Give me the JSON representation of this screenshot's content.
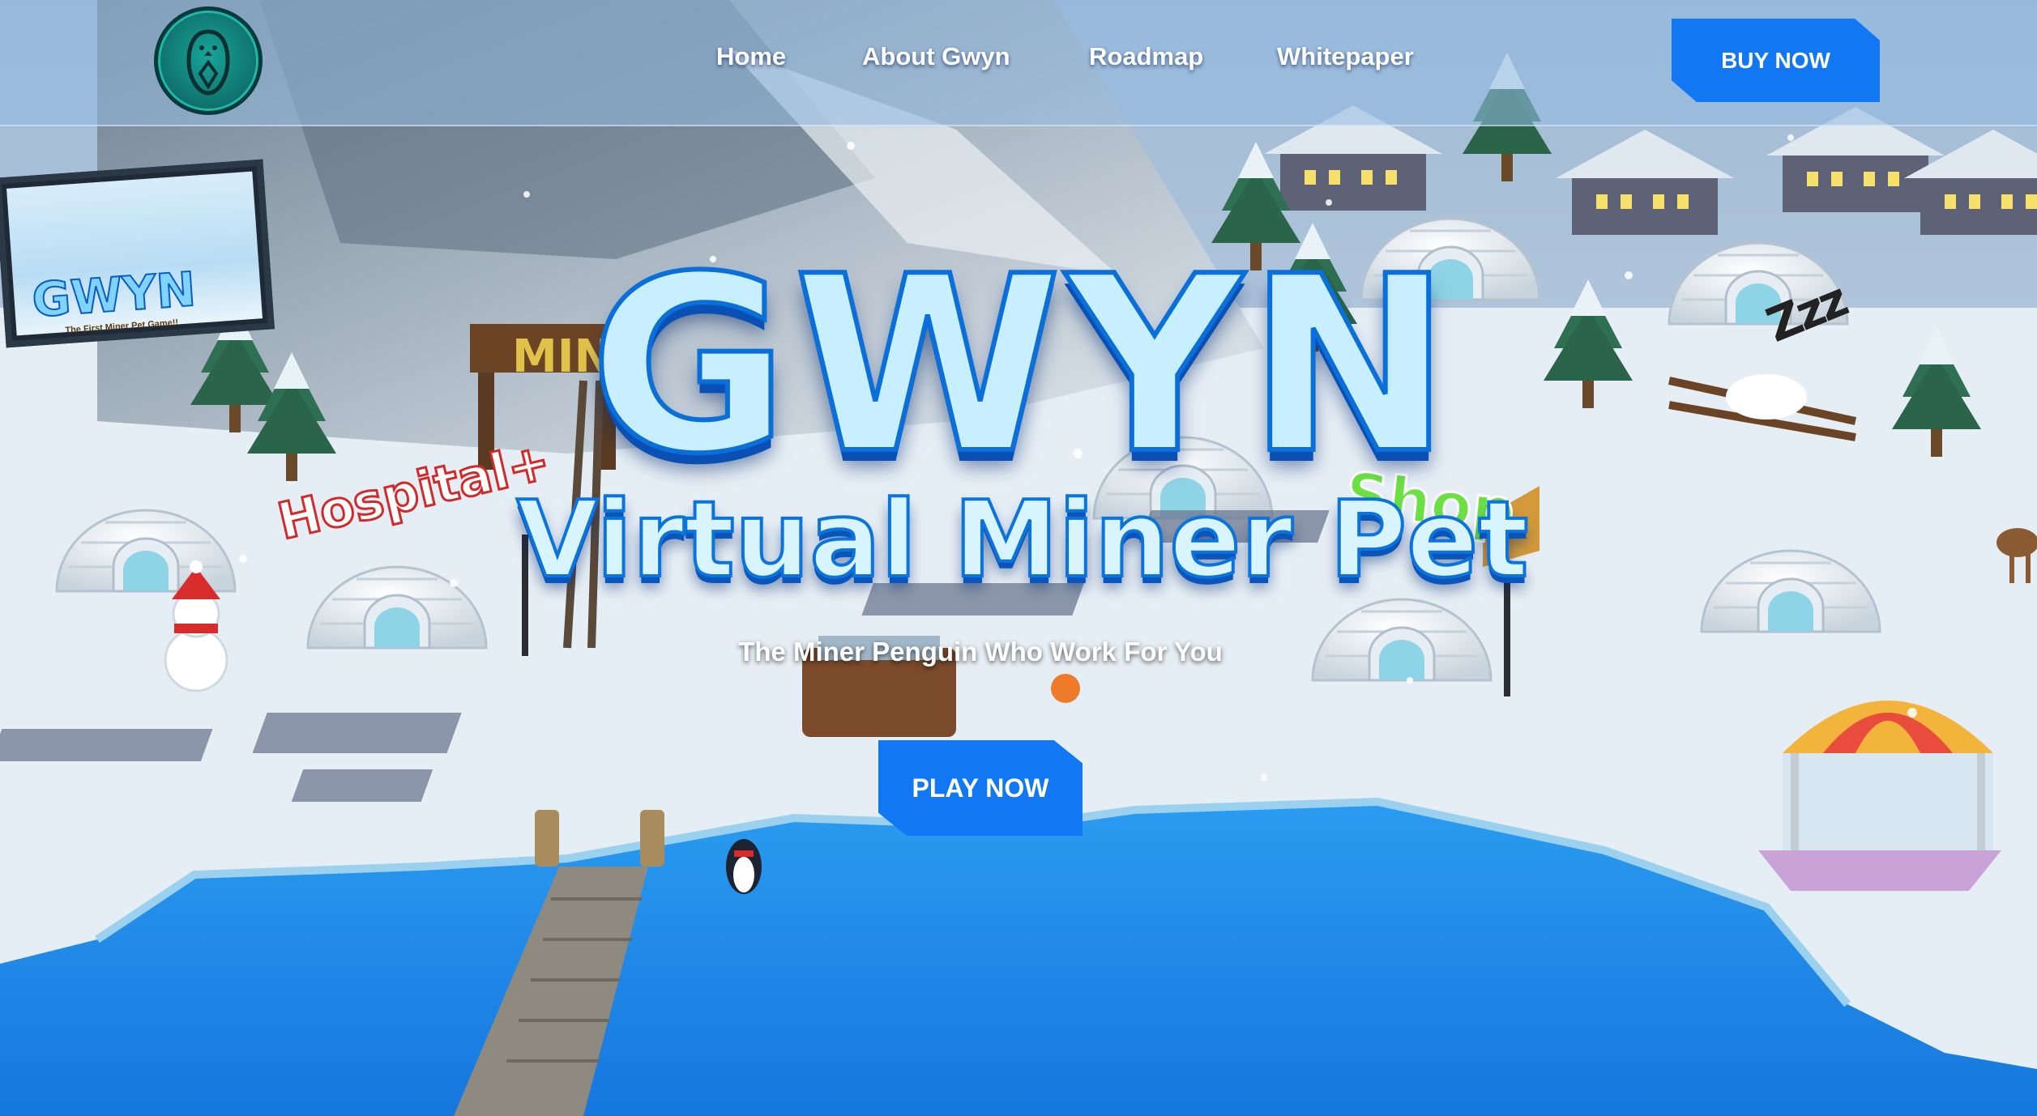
{
  "brand": {
    "logo_icon": "penguin-gem-icon"
  },
  "nav": {
    "items": [
      {
        "label": "Home"
      },
      {
        "label": "About Gwyn"
      },
      {
        "label": "Roadmap"
      },
      {
        "label": "Whitepaper"
      }
    ],
    "buy_label": "BUY NOW"
  },
  "hero": {
    "title": "GWYN",
    "subtitle": "Virtual Miner Pet",
    "tagline": "The Miner Penguin Who Work For You",
    "play_label": "PLAY NOW"
  },
  "scene": {
    "signs": {
      "hospital": "Hospital+",
      "shop": "Shop",
      "mine": "MIN",
      "sleep": "Zzz"
    },
    "screen": {
      "title": "GWYN",
      "caption": "The First Miner Pet Game!!"
    }
  },
  "colors": {
    "accent": "#1177f2",
    "title_fill": "#c8efff",
    "title_stroke": "#0a6fd8",
    "water": "#1e8fe8",
    "snow": "#eef4f8"
  }
}
